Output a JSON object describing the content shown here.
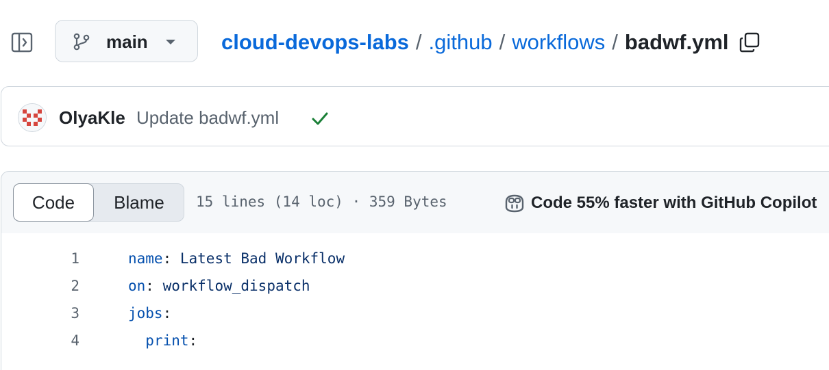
{
  "toolbar": {
    "branch": "main"
  },
  "breadcrumb": {
    "repo": "cloud-devops-labs",
    "sep": "/",
    "folder1": ".github",
    "folder2": "workflows",
    "file": "badwf.yml"
  },
  "commit": {
    "author": "OlyaKle",
    "message": "Update badwf.yml",
    "status": "success",
    "status_color": "#1a7f37"
  },
  "file_header": {
    "tabs": [
      {
        "label": "Code",
        "active": true
      },
      {
        "label": "Blame",
        "active": false
      }
    ],
    "stats": "15 lines (14 loc) · 359 Bytes",
    "copilot_label": "Code 55% faster with GitHub Copilot"
  },
  "code": {
    "lines": [
      {
        "num": "1",
        "key": "name",
        "colon": ":",
        "value": " Latest Bad Workflow",
        "indent": ""
      },
      {
        "num": "2",
        "key": "on",
        "colon": ":",
        "value": " workflow_dispatch",
        "indent": ""
      },
      {
        "num": "3",
        "key": "jobs",
        "colon": ":",
        "value": "",
        "indent": ""
      },
      {
        "num": "4",
        "key": "print",
        "colon": ":",
        "value": "",
        "indent": "  "
      }
    ]
  },
  "colors": {
    "link": "#0969da",
    "key": "#0550ae",
    "value": "#0a3069",
    "muted": "#59636e",
    "border": "#d0d7de"
  }
}
